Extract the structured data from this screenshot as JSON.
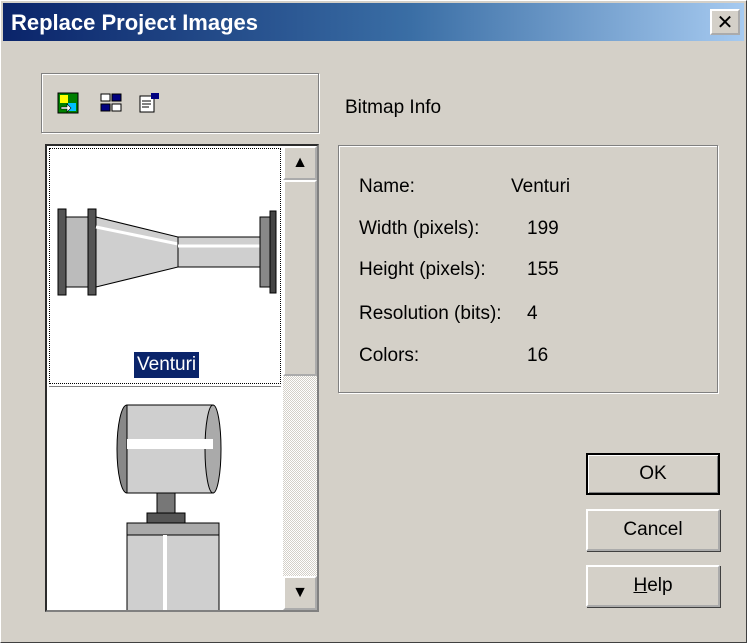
{
  "window": {
    "title": "Replace Project Images",
    "close_glyph": "✕"
  },
  "toolbar": {
    "icons": [
      "replace-image-icon",
      "image-list-icon",
      "properties-icon"
    ]
  },
  "image_list": {
    "items": [
      {
        "label": "Venturi",
        "selected": true
      },
      {
        "label": "",
        "selected": false
      }
    ],
    "scroll_up_glyph": "▲",
    "scroll_down_glyph": "▼"
  },
  "bitmap_info": {
    "heading": "Bitmap Info",
    "name_label": "Name:",
    "name_value": "Venturi",
    "width_label": "Width (pixels):",
    "width_value": "199",
    "height_label": "Height (pixels):",
    "height_value": "155",
    "resolution_label": "Resolution (bits):",
    "resolution_value": "4",
    "colors_label": "Colors:",
    "colors_value": "16"
  },
  "buttons": {
    "ok": "OK",
    "cancel": "Cancel",
    "help_first": "H",
    "help_rest": "elp"
  },
  "colors": {
    "title_bar_start": "#0a246a",
    "title_bar_end": "#a6caf0",
    "dialog_face": "#d4d0c8",
    "selection": "#0a246a"
  }
}
